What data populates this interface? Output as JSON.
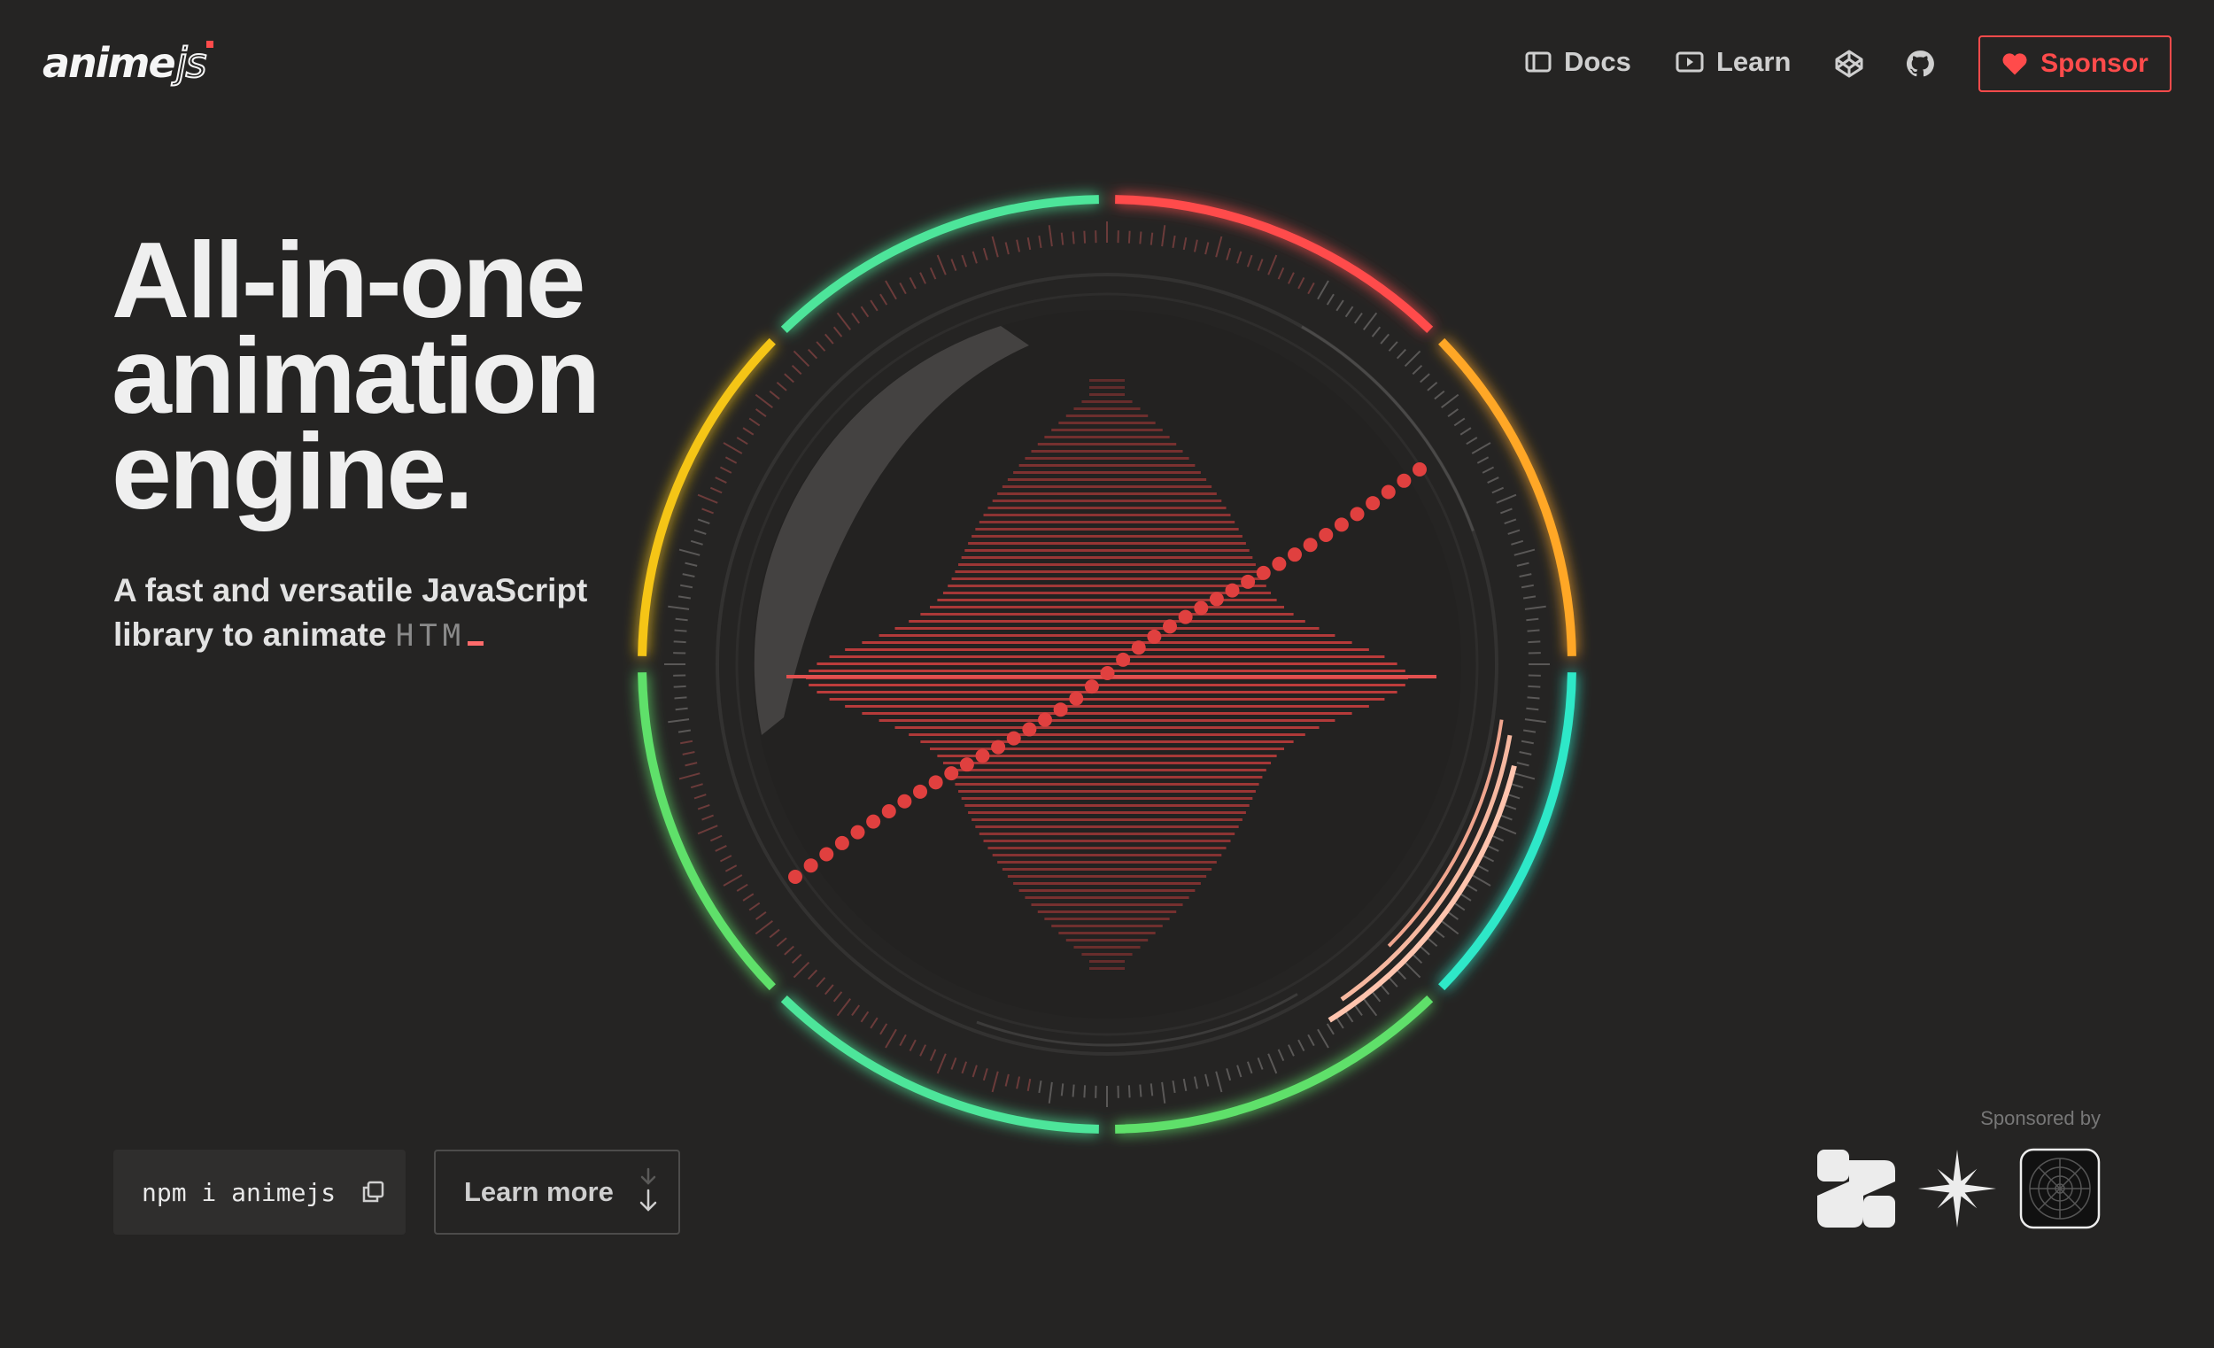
{
  "brand": {
    "logo_main": "anime",
    "logo_suffix": "js",
    "accent": "#ff4b4b"
  },
  "nav": {
    "docs_label": "Docs",
    "learn_label": "Learn",
    "codepen_icon": "codepen-icon",
    "github_icon": "github-icon",
    "sponsor_label": "Sponsor"
  },
  "hero": {
    "title_line1": "All-in-one",
    "title_line2": "animation",
    "title_line3": "engine.",
    "subtitle_line1": "A fast and versatile JavaScript",
    "subtitle_line2": "library to animate",
    "typing_text": "HTM"
  },
  "cta": {
    "install_command": "npm i animejs",
    "copy_icon": "copy-icon",
    "learn_more_label": "Learn more",
    "learn_more_icon": "arrow-down-icon"
  },
  "sponsors": {
    "label": "Sponsored by",
    "logos": [
      "sponsor-logo-1",
      "sponsor-logo-2",
      "sponsor-logo-3"
    ]
  },
  "colors": {
    "background": "#252423",
    "ring_red": "#ff4b4b",
    "ring_orange": "#ffa726",
    "ring_yellow": "#f5c518",
    "ring_green": "#5fe06a",
    "ring_teal": "#2de8c8",
    "ring_mint": "#4ee59a"
  }
}
